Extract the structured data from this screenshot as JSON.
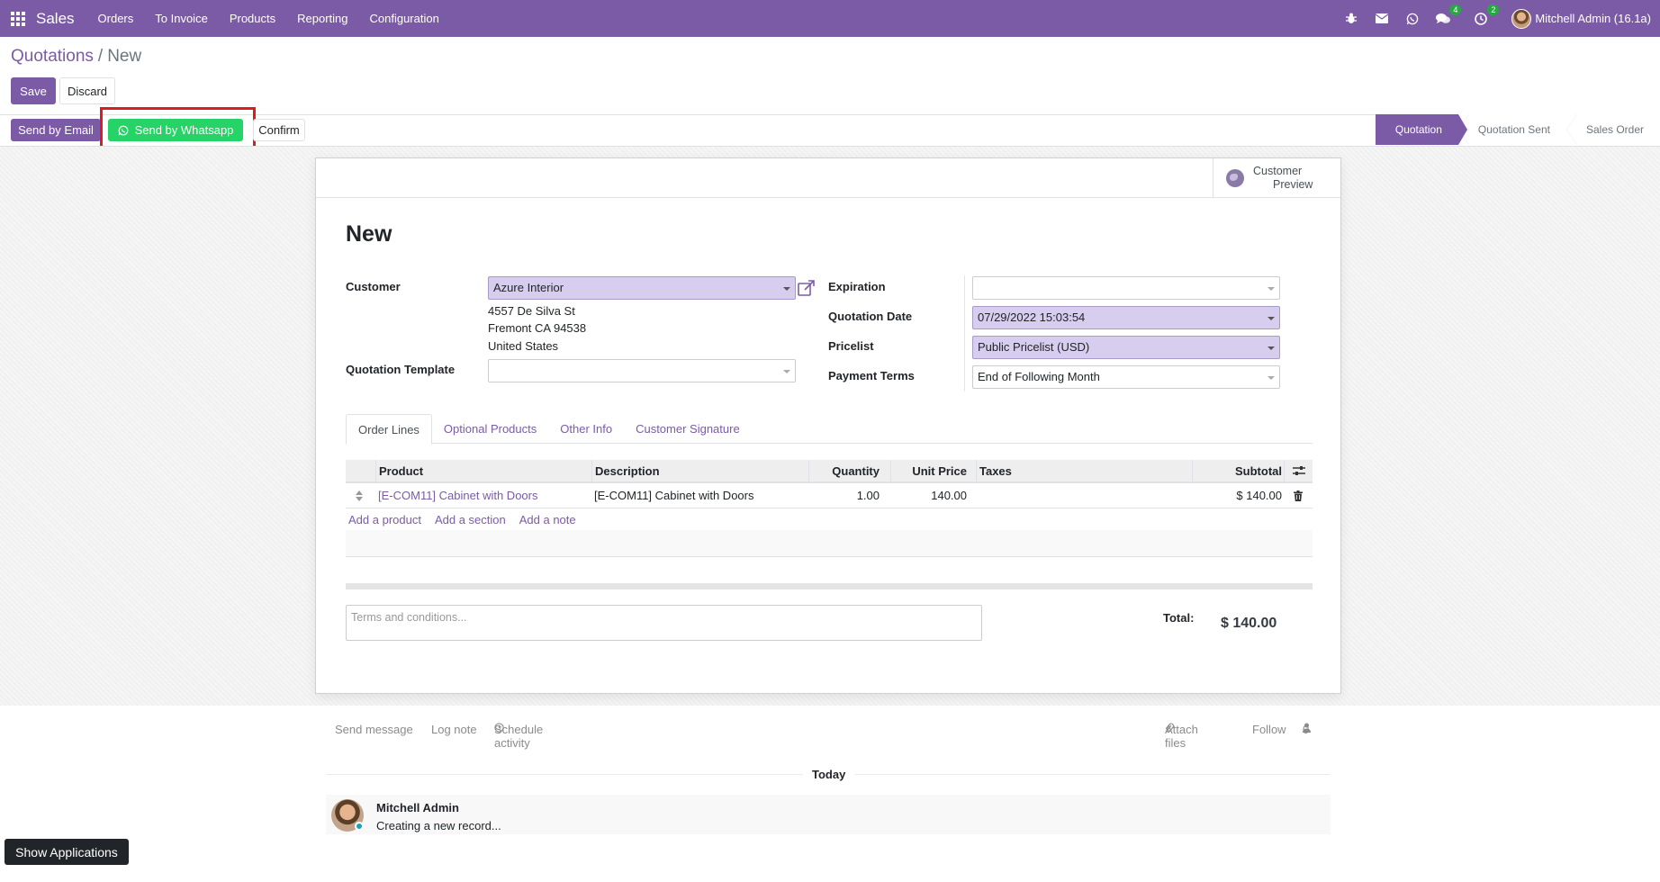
{
  "navbar": {
    "brand": "Sales",
    "menu": [
      "Orders",
      "To Invoice",
      "Products",
      "Reporting",
      "Configuration"
    ],
    "messages_badge": "4",
    "activities_badge": "2",
    "user": "Mitchell Admin (16.1a)"
  },
  "breadcrumb": {
    "parent": "Quotations",
    "separator": "/",
    "current": "New"
  },
  "buttons": {
    "save": "Save",
    "discard": "Discard",
    "send_email": "Send by Email",
    "send_whatsapp": "Send by Whatsapp",
    "confirm": "Confirm"
  },
  "statusbar": [
    "Quotation",
    "Quotation Sent",
    "Sales Order"
  ],
  "sheet": {
    "customer_preview": [
      "Customer",
      "Preview"
    ],
    "title": "New",
    "fields": {
      "customer_label": "Customer",
      "customer_value": "Azure Interior",
      "address": [
        "4557 De Silva St",
        "Fremont CA 94538",
        "United States"
      ],
      "template_label": "Quotation Template",
      "template_value": "",
      "expiration_label": "Expiration",
      "expiration_value": "",
      "quotation_date_label": "Quotation Date",
      "quotation_date_value": "07/29/2022 15:03:54",
      "pricelist_label": "Pricelist",
      "pricelist_value": "Public Pricelist (USD)",
      "payment_terms_label": "Payment Terms",
      "payment_terms_value": "End of Following Month"
    },
    "tabs": [
      "Order Lines",
      "Optional Products",
      "Other Info",
      "Customer Signature"
    ],
    "table": {
      "headers": [
        "Product",
        "Description",
        "Quantity",
        "Unit Price",
        "Taxes",
        "Subtotal"
      ],
      "rows": [
        {
          "product": "[E-COM11] Cabinet with Doors",
          "description": "[E-COM11] Cabinet with Doors",
          "quantity": "1.00",
          "unit_price": "140.00",
          "taxes": "",
          "subtotal": "$ 140.00"
        }
      ],
      "add_links": [
        "Add a product",
        "Add a section",
        "Add a note"
      ]
    },
    "terms_placeholder": "Terms and conditions...",
    "total_label": "Total:",
    "total_value": "$ 140.00"
  },
  "chatter": {
    "send_message": "Send message",
    "log_note": "Log note",
    "schedule_activity": "Schedule activity",
    "attach_files": "Attach files",
    "follow": "Follow",
    "followers": "0",
    "today": "Today",
    "message": {
      "author": "Mitchell Admin",
      "body": "Creating a new record..."
    }
  },
  "show_applications": "Show Applications",
  "colors": {
    "brand": "#7c5ba6",
    "whatsapp": "#25d366",
    "highlight": "#e01b1b",
    "required_field": "#d7cdee"
  }
}
